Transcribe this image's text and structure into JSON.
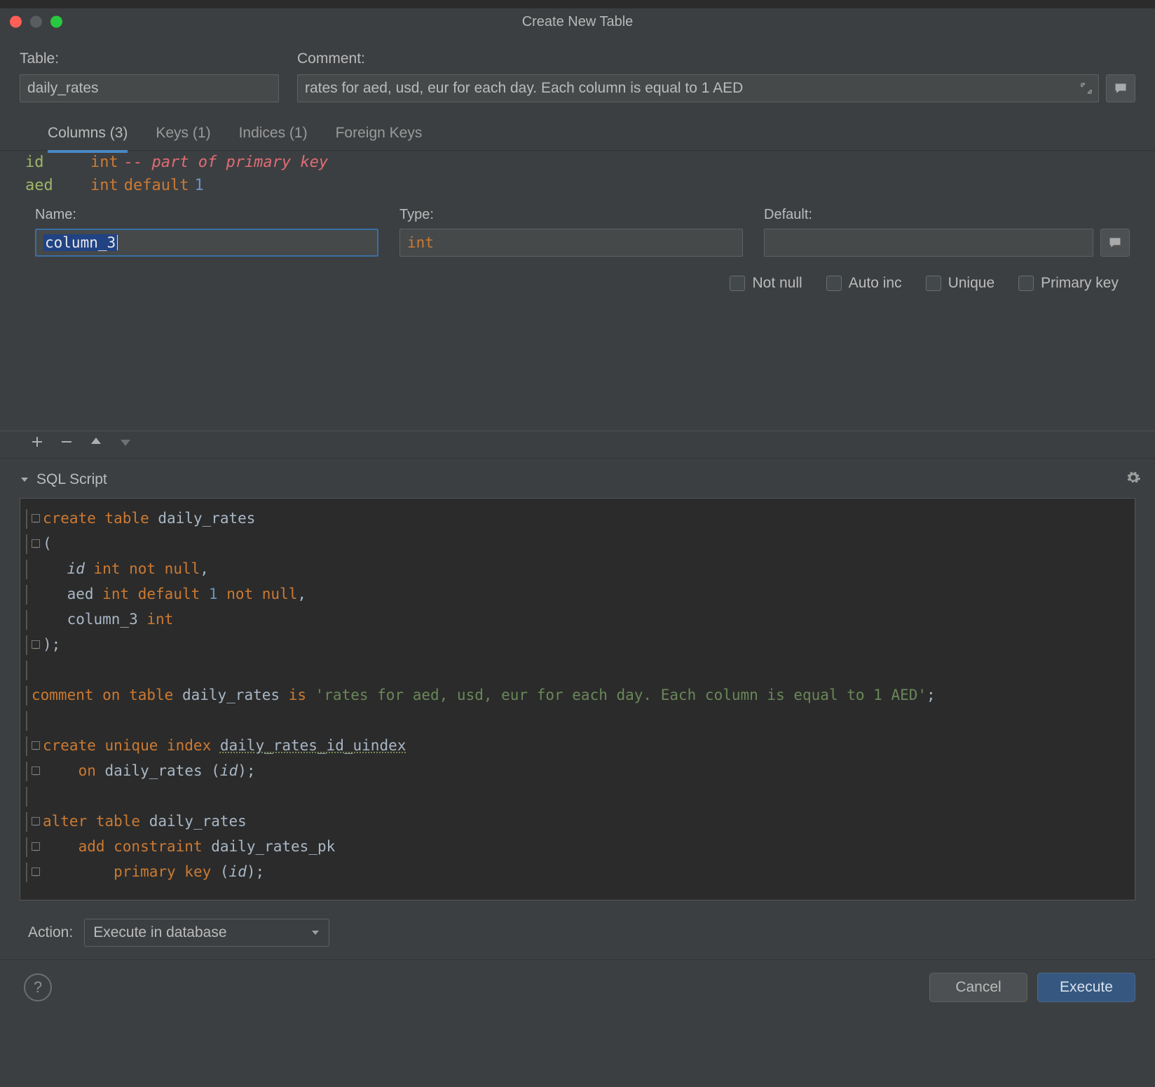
{
  "window": {
    "title": "Create New Table"
  },
  "labels": {
    "table": "Table:",
    "comment": "Comment:",
    "name": "Name:",
    "type": "Type:",
    "default": "Default:",
    "not_null": "Not null",
    "auto_inc": "Auto inc",
    "unique": "Unique",
    "primary_key": "Primary key",
    "sql_script": "SQL Script",
    "action": "Action:"
  },
  "tabs": {
    "columns": "Columns (3)",
    "keys": "Keys (1)",
    "indices": "Indices (1)",
    "foreign_keys": "Foreign Keys"
  },
  "form": {
    "table_name": "daily_rates",
    "comment": "rates for aed, usd, eur for each day. Each column is equal to 1 AED"
  },
  "columns": [
    {
      "name": "id",
      "type": "int",
      "note": "-- part of primary key",
      "default": ""
    },
    {
      "name": "aed",
      "type": "int",
      "default_kw": "default",
      "default": "1"
    }
  ],
  "column_edit": {
    "name": "column_3",
    "type": "int",
    "default": "",
    "not_null": false,
    "auto_inc": false,
    "unique": false,
    "primary_key": false
  },
  "action_select": "Execute in database",
  "sql": {
    "create": "create table",
    "tbl": "daily_rates",
    "open": "(",
    "l1a": "id",
    "l1b": "int not null",
    "l1c": ",",
    "l2a": "aed",
    "l2b": "int default",
    "l2n": "1",
    "l2c": "not null",
    "l2d": ",",
    "l3a": "column_3",
    "l3b": "int",
    "close": ");",
    "cmt1": "comment on table",
    "cmt2": "daily_rates",
    "cmt3": "is",
    "cmtstr": "'rates for aed, usd, eur for each day. Each column is equal to 1 AED'",
    "cmt4": ";",
    "ci1": "create unique index",
    "ci2": "daily_rates_id_uindex",
    "ci3": "on",
    "ci4": "daily_rates",
    "ci5": "(",
    "ci6": "id",
    "ci7": ");",
    "at1": "alter table",
    "at2": "daily_rates",
    "at3": "add constraint",
    "at4": "daily_rates_pk",
    "at5": "primary key",
    "at6": "(",
    "at7": "id",
    "at8": ");"
  },
  "buttons": {
    "cancel": "Cancel",
    "execute": "Execute"
  }
}
